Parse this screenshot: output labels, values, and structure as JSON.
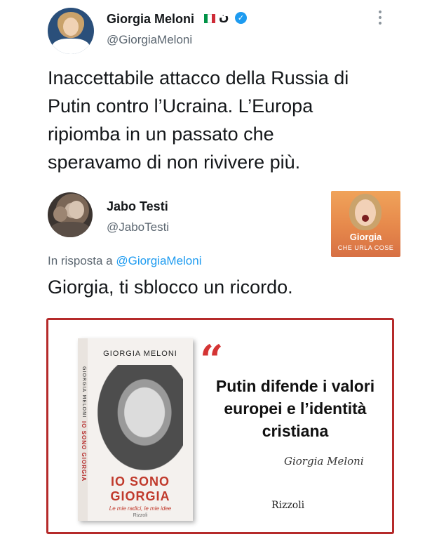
{
  "tweet": {
    "author_name": "Giorgia Meloni",
    "author_suffix": "ن",
    "verified_glyph": "✓",
    "handle": "@GiorgiaMeloni",
    "more_glyph": "•\n•\n•",
    "text": "Inaccettabile attacco della Russia di\nPutin contro l’Ucraina. L’Europa\nripiomba in un passato che\nsperavamo di non rivivere più.",
    "flag_colors": [
      "#009246",
      "#ffffff",
      "#ce2b37"
    ]
  },
  "quoted": {
    "author_name": "Jabo Testi",
    "handle": "@JaboTesti",
    "reply_prefix": "In risposta a",
    "reply_to": "@GiorgiaMeloni",
    "text": "Giorgia, ti sblocco un ricordo.",
    "thumbnail": {
      "title": "Giorgia",
      "subtitle": "CHE URLA COSE"
    }
  },
  "media": {
    "book": {
      "author": "GIORGIA MELONI",
      "spine_author": "GIORGIA MELONI",
      "spine_title": "IO SONO GIORGIA",
      "title_line1": "IO SONO",
      "title_line2": "GIORGIA",
      "subtitle": "Le mie radici, le mie idee",
      "publisher": "Rizzoli"
    },
    "quote_mark": "“",
    "quote": "Putin difende i valori europei e l’identità cristiana",
    "signature": "Giorgia Meloni",
    "publisher": "Rizzoli",
    "accent_color": "#b52a2a"
  }
}
